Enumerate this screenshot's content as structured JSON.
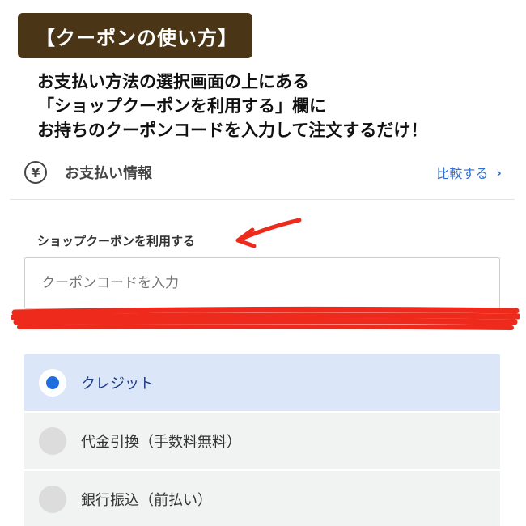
{
  "banner": {
    "title": "【クーポンの使い方】"
  },
  "instructions": {
    "lines": [
      "お支払い方法の選択画面の上にある",
      "「ショップクーポンを利用する」欄に",
      "お持ちのクーポンコードを入力して注文するだけ！"
    ]
  },
  "payment_header": {
    "icon": "yen-icon",
    "icon_glyph": "¥",
    "title": "お支払い情報",
    "compare_link": "比較する",
    "compare_chevron": "›"
  },
  "coupon": {
    "label": "ショップクーポンを利用する",
    "placeholder": "クーポンコードを入力"
  },
  "payment_options": [
    {
      "label": "クレジット",
      "selected": true
    },
    {
      "label": "代金引換（手数料無料）",
      "selected": false
    },
    {
      "label": "銀行振込（前払い）",
      "selected": false
    }
  ],
  "colors": {
    "banner_bg": "#4a3516",
    "link": "#2f6fd6",
    "selected_bg": "#dbe6f8",
    "radio_selected": "#1f6fe0",
    "annotation_red": "#ee2a1c"
  }
}
